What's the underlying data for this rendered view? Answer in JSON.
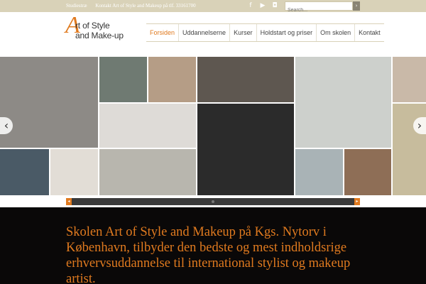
{
  "topbar": {
    "location": "Studiestræ",
    "contact": "Kontakt Art of Style and Makeup på tlf. 33161700",
    "social": [
      {
        "icon": "facebook-icon",
        "glyph": "f"
      },
      {
        "icon": "youtube-icon",
        "glyph": "▶"
      },
      {
        "icon": "instagram-icon",
        "glyph": "◘"
      }
    ],
    "search_placeholder": "Search...",
    "search_button_glyph": "›"
  },
  "logo": {
    "mark": "A",
    "line1": "rt of Style",
    "line2": "and Make-up"
  },
  "nav": {
    "items": [
      {
        "label": "Forsiden",
        "active": true
      },
      {
        "label": "Uddannelserne",
        "active": false
      },
      {
        "label": "Kurser",
        "active": false
      },
      {
        "label": "Holdstart og priser",
        "active": false
      },
      {
        "label": "Om skolen",
        "active": false
      },
      {
        "label": "Kontakt",
        "active": false
      }
    ]
  },
  "gallery": {
    "prev_glyph": "‹",
    "next_glyph": "›",
    "tiles": [
      {
        "name": "photo-collage",
        "color": "#8d8a86"
      },
      {
        "name": "photo-clown-makeup",
        "color": "#6f7a72"
      },
      {
        "name": "photo-makeup-application",
        "color": "#b59d86"
      },
      {
        "name": "photo-ruffled-collar",
        "color": "#5e5750"
      },
      {
        "name": "photo-beach-woman",
        "color": "#cdd0cc"
      },
      {
        "name": "photo-white-shirt",
        "color": "#c9b9a8"
      },
      {
        "name": "photo-white-dress-sitting",
        "color": "#dedbd7"
      },
      {
        "name": "photo-bw-portrait",
        "color": "#2b2b2b"
      },
      {
        "name": "photo-blue-dress",
        "color": "#4a5a66"
      },
      {
        "name": "photo-white-top",
        "color": "#e2ddd6"
      },
      {
        "name": "photo-beach-gown",
        "color": "#b8b6ae"
      },
      {
        "name": "photo-perfume-bottle",
        "color": "#a9b3b6"
      },
      {
        "name": "photo-curly-hair",
        "color": "#8e6e56"
      },
      {
        "name": "photo-se-sign",
        "color": "#c7bc9d"
      }
    ]
  },
  "intro": {
    "text": "Skolen Art of Style and Makeup på Kgs. Nytorv i København, tilbyder den bedste og mest indholdsrige erhvervsuddannelse til international stylist og makeup artist."
  },
  "colors": {
    "accent": "#e07a1f",
    "topbar": "#d9d2b8",
    "intro_bg": "#0a0808"
  }
}
